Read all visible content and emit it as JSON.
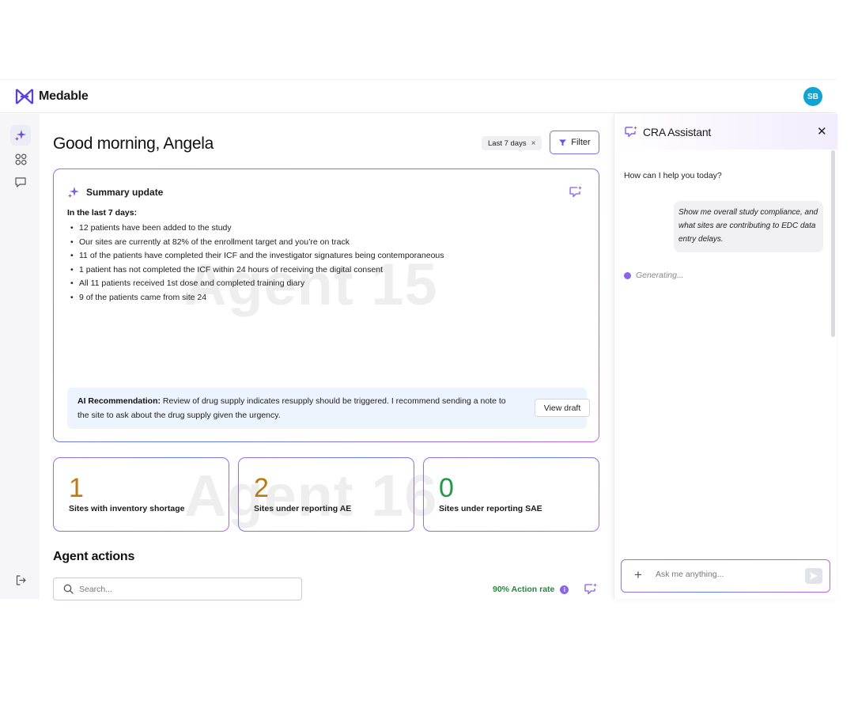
{
  "brand": {
    "name": "Medable",
    "accent": "#5b3df0"
  },
  "user": {
    "initials": "SB",
    "avatar_color": "#0fa4d6"
  },
  "sidebar": {
    "items": [
      {
        "icon": "sparkle-icon",
        "active": true
      },
      {
        "icon": "grid-icon",
        "active": false
      },
      {
        "icon": "chat-icon",
        "active": false
      }
    ],
    "footer_icon": "logout-icon"
  },
  "main": {
    "greeting": "Good morning, Angela",
    "filter_chip": "Last 7 days",
    "filter_chip_close": "×",
    "filter_button": "Filter"
  },
  "summary": {
    "title": "Summary update",
    "period": "In the last 7 days:",
    "bullets": [
      "12 patients have been added to the study",
      "Our sites are currently at 82% of the enrollment target and you’re on track",
      "11 of the patients have completed their ICF and the investigator signatures being contemporaneous",
      "1 patient has not completed the ICF within 24 hours of receiving the digital consent",
      "All 11 patients received 1st dose and completed training diary",
      "9 of the patients came from site 24"
    ],
    "watermark": "Agent 15",
    "recommendation_label": "AI Recommendation:",
    "recommendation_text": " Review of drug supply indicates resupply should be triggered. I recommend sending a note to the site to ask about the drug supply given the urgency.",
    "draft_button": "View draft"
  },
  "stats": [
    {
      "value": "1",
      "label": "Sites with inventory shortage",
      "color": "#c07a0b"
    },
    {
      "value": "2",
      "label": "Sites under reporting AE",
      "color": "#c07a0b"
    },
    {
      "value": "0",
      "label": "Sites under reporting SAE",
      "color": "#1f9a45"
    }
  ],
  "stats_watermark": "Agent 16",
  "actions": {
    "title": "Agent actions",
    "search_placeholder": "Search...",
    "action_rate": "90% Action rate",
    "info_glyph": "i"
  },
  "assistant": {
    "title": "CRA Assistant",
    "close": "✕",
    "greeting": "How can I help you today?",
    "user_message": "Show me overall study compliance, and what sites are contributing to EDC data entry delays.",
    "status": "Generating...",
    "input_placeholder": "Ask me anything...",
    "plus": "+"
  }
}
